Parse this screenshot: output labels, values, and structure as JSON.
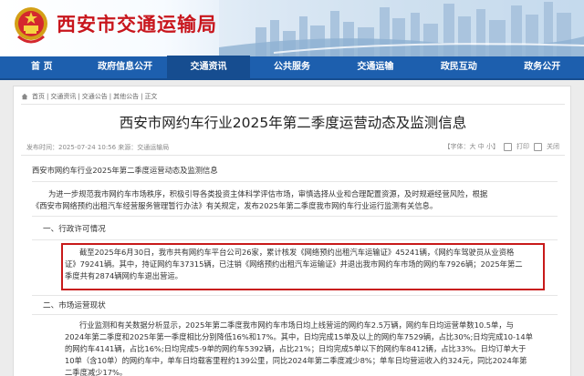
{
  "site": {
    "title": "西安市交通运输局"
  },
  "nav": {
    "items": [
      "首  页",
      "政府信息公开",
      "交通资讯",
      "公共服务",
      "交通运输",
      "政民互动",
      "政务公开"
    ]
  },
  "breadcrumb": {
    "items": [
      "首页",
      "交通资讯",
      "交通公告",
      "其他公告",
      "正文"
    ],
    "separator": "|"
  },
  "article": {
    "title": "西安市网约车行业2025年第二季度运营动态及监测信息",
    "meta_left": "发布时间：2025-07-24 10:56     来源：交通运输局",
    "font_label": "【字体：大 中 小】",
    "print_label": "打印",
    "close_label": "关闭",
    "p1": "西安市网约车行业2025年第二季度运营动态及监测信息",
    "p2_lines": [
      "为进一步规范我市网约车市场秩序，积极引导各类投资主体科学评估市场，审慎选择从业和合理配置资源，及时规避经营风险，根据",
      "《西安市网络预约出租汽车经营服务管理暂行办法》有关规定，发布2025年第二季度我市网约车行业运行监测有关信息。"
    ],
    "section1": "一、行政许可情况",
    "license_lines": [
      "截至2025年6月30日，我市共有网约车平台公司26家，累计核发《网络预约出租汽车运输证》45241辆，《网约车驾驶员从业资格",
      "证》79241辆。其中，持证网约车37315辆，已注销《网络预约出租汽车运输证》并退出我市网约车市场的网约车7926辆；2025年第二",
      "季度共有2874辆网约车退出营运。"
    ],
    "section2": "二、市场运营现状",
    "market_lines": [
      "行业监测和有关数据分析显示，2025年第二季度我市网约车市场日均上线营运的网约车2.5万辆，网约车日均运营单数10.5单，与",
      "2024年第二季度和2025年第一季度相比分别降低16%和17%。其中，日均完成15单及以上的网约车7529辆，占比30%;日均完成10-14单",
      "的网约车4141辆，占比16%;日均完成5-9单的网约车5392辆，占比21%；日均完成5单以下的网约车8412辆，占比33%。日均订单大于",
      "10单（含10单）的网约车中，单车日均载客里程约139公里，同比2024年第二季度减少8%；单车日均营运收入约324元，同比2024年第",
      "二季度减少17%。"
    ]
  },
  "colors": {
    "brand_red": "#c8161d",
    "nav_blue": "#1d5fae",
    "highlight_red": "#c81a1a"
  }
}
